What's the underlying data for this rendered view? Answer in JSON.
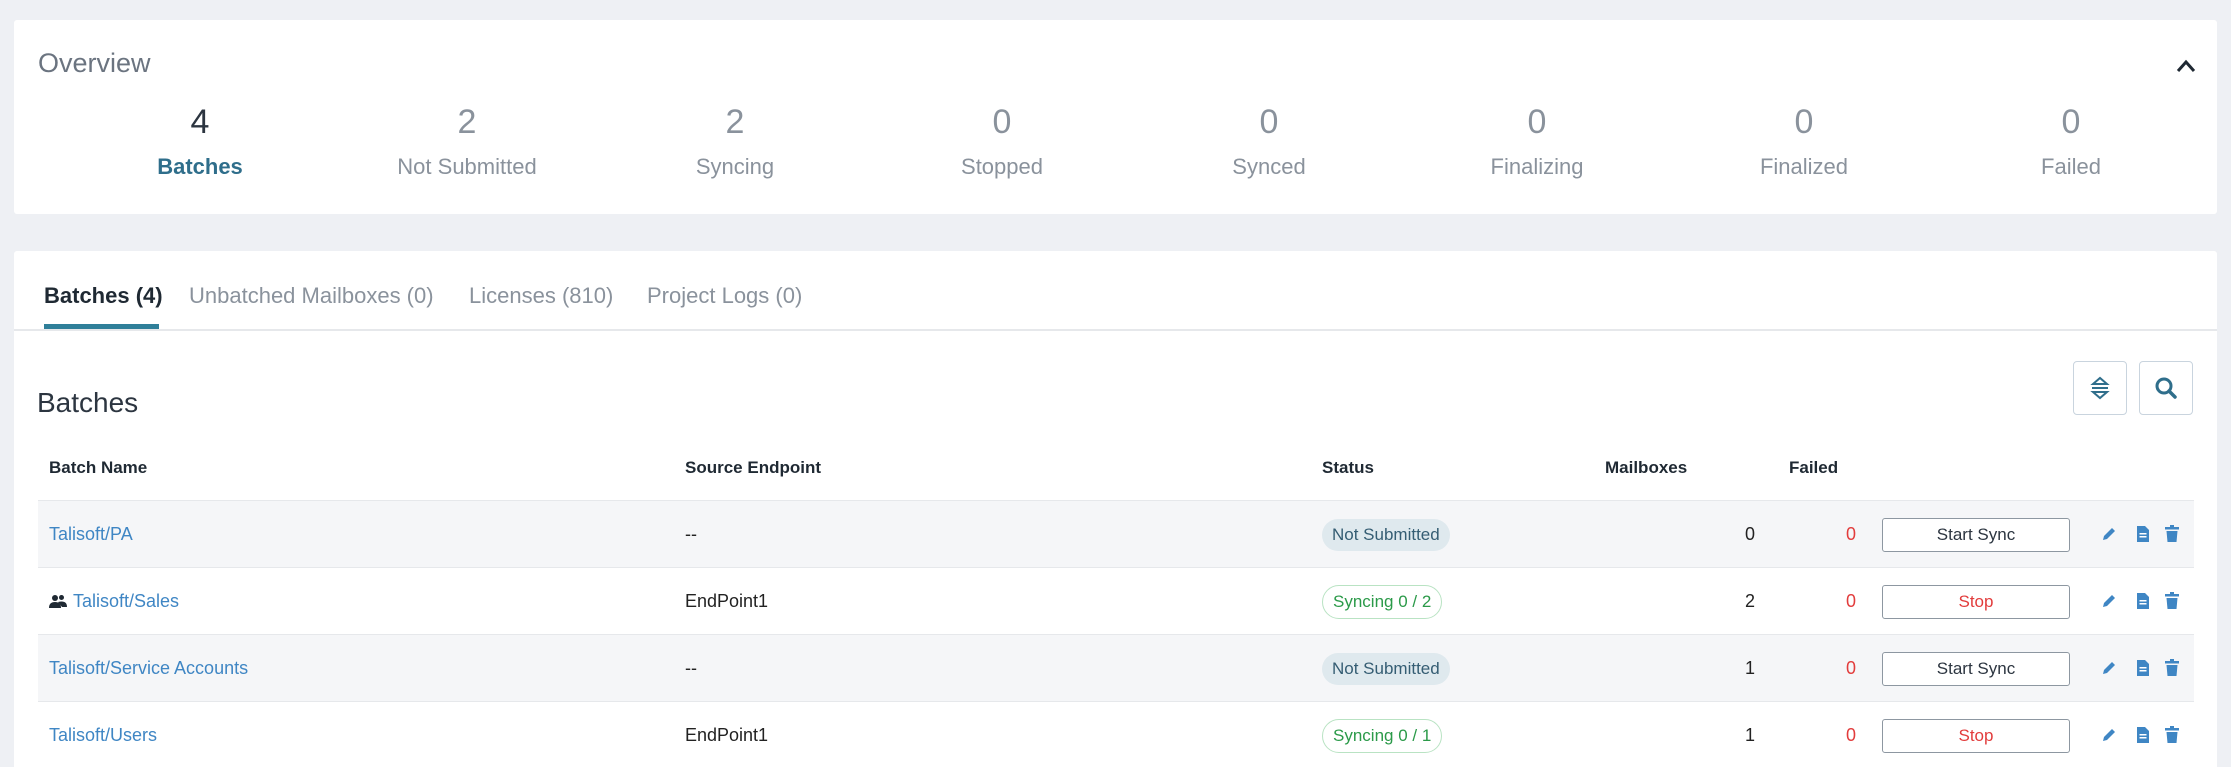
{
  "colors": {
    "accent": "#2f7f99",
    "link": "#3f86c4",
    "danger": "#e23c3c",
    "success": "#2b9a49"
  },
  "overview": {
    "title": "Overview",
    "collapse_icon": "chevron-up-icon",
    "stats": [
      {
        "value": "4",
        "label": "Batches"
      },
      {
        "value": "2",
        "label": "Not Submitted"
      },
      {
        "value": "2",
        "label": "Syncing"
      },
      {
        "value": "0",
        "label": "Stopped"
      },
      {
        "value": "0",
        "label": "Synced"
      },
      {
        "value": "0",
        "label": "Finalizing"
      },
      {
        "value": "0",
        "label": "Finalized"
      },
      {
        "value": "0",
        "label": "Failed"
      }
    ]
  },
  "tabs": [
    {
      "label": "Batches (4)"
    },
    {
      "label": "Unbatched Mailboxes (0)"
    },
    {
      "label": "Licenses (810)"
    },
    {
      "label": "Project Logs (0)"
    }
  ],
  "batches": {
    "title": "Batches",
    "toolbar_icons": [
      "sort-icon",
      "search-icon"
    ],
    "columns": [
      "Batch Name",
      "Source Endpoint",
      "Status",
      "Mailboxes",
      "Failed"
    ],
    "rows": [
      {
        "name": "Talisoft/PA",
        "source": "--",
        "status": "Not Submitted",
        "mailboxes": "0",
        "failed": "0",
        "action": "Start Sync"
      },
      {
        "name": "Talisoft/Sales",
        "source": "EndPoint1",
        "status": "Syncing  0 / 2",
        "mailboxes": "2",
        "failed": "0",
        "action": "Stop"
      },
      {
        "name": "Talisoft/Service Accounts",
        "source": "--",
        "status": "Not Submitted",
        "mailboxes": "1",
        "failed": "0",
        "action": "Start Sync"
      },
      {
        "name": "Talisoft/Users",
        "source": "EndPoint1",
        "status": "Syncing  0 / 1",
        "mailboxes": "1",
        "failed": "0",
        "action": "Stop"
      }
    ]
  }
}
